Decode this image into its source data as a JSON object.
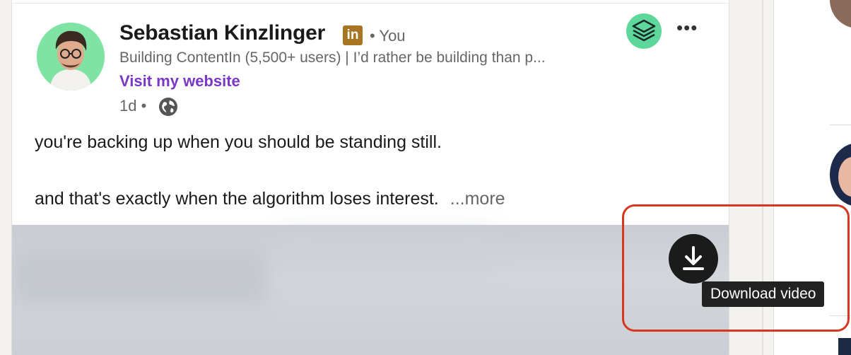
{
  "post": {
    "author": {
      "name": "Sebastian Kinzlinger",
      "badge": "in",
      "relation": "• You",
      "headline": "Building ContentIn (5,500+ users) | I’d rather be building than p...",
      "website_label": "Visit my website"
    },
    "timestamp": "1d •",
    "visibility_icon": "globe-icon",
    "menu_label": "•••",
    "text_lines": [
      "you're backing up when you should be standing still.",
      "and that's exactly when the algorithm loses interest."
    ],
    "more_label": "...more"
  },
  "extension": {
    "tooltip": "Download video",
    "download_icon": "download-icon",
    "highlight_color": "#d7361f"
  },
  "colors": {
    "link": "#7a36c4",
    "linkedin_badge": "#a87522",
    "avatar_bg": "#7fe3a4",
    "app_badge": "#5dd79a"
  }
}
